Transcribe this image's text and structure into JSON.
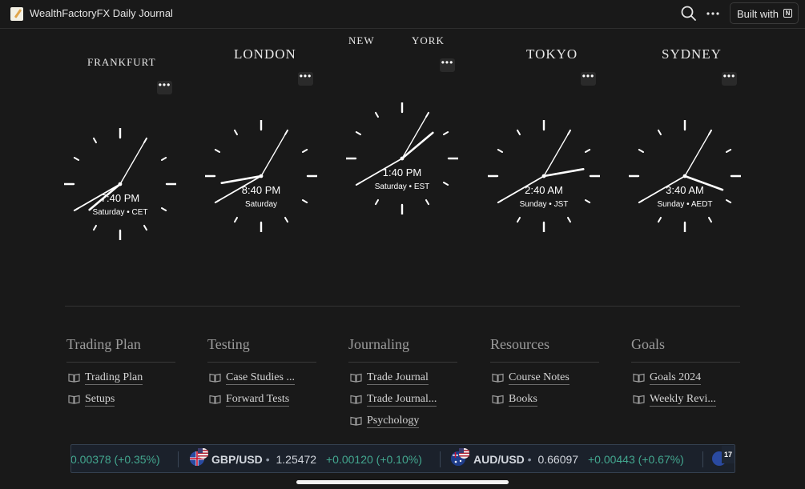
{
  "topbar": {
    "title": "WealthFactoryFX Daily Journal",
    "built_with_label": "Built with",
    "notion_logo_letter": "N"
  },
  "clocks": [
    {
      "city": "FRANKFURT",
      "time": "7:40 PM",
      "detail": "Saturday • CET",
      "hour": 19,
      "minute": 40
    },
    {
      "city": "LONDON",
      "time": "8:40 PM",
      "detail": "Saturday",
      "hour": 20,
      "minute": 40
    },
    {
      "city_parts": [
        "NEW",
        "YORK"
      ],
      "time": "1:40 PM",
      "detail": "Saturday • EST",
      "hour": 13,
      "minute": 40
    },
    {
      "city": "TOKYO",
      "time": "2:40 AM",
      "detail": "Sunday • JST",
      "hour": 2,
      "minute": 40
    },
    {
      "city": "SYDNEY",
      "time": "3:40 AM",
      "detail": "Sunday • AEDT",
      "hour": 3,
      "minute": 40
    }
  ],
  "more_glyph": "•••",
  "columns": [
    {
      "heading": "Trading Plan",
      "links": [
        "Trading Plan",
        "Setups"
      ]
    },
    {
      "heading": "Testing",
      "links": [
        "Case Studies ...",
        "Forward Tests"
      ]
    },
    {
      "heading": "Journaling",
      "links": [
        "Trade Journal",
        "Trade Journal...",
        "Psychology"
      ]
    },
    {
      "heading": "Resources",
      "links": [
        "Course Notes",
        "Books"
      ]
    },
    {
      "heading": "Goals",
      "links": [
        "Goals 2024",
        "Weekly Revi..."
      ]
    }
  ],
  "ticker": {
    "partial_change": "0.00378 (+0.35%)",
    "items": [
      {
        "symbol": "GBP/USD",
        "price": "1.25472",
        "change": "+0.00120 (+0.10%)"
      },
      {
        "symbol": "AUD/USD",
        "price": "0.66097",
        "change": "+0.00443 (+0.67%)"
      }
    ],
    "separator_dot": "•",
    "logo_text": "17",
    "colors": {
      "up": "#43a78f",
      "background": "#1b212b"
    }
  }
}
